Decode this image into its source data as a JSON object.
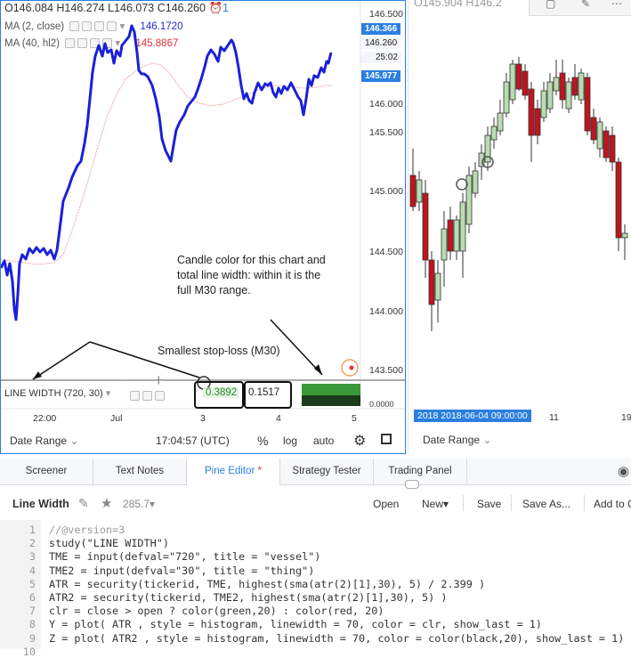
{
  "left_chart": {
    "ohlc": {
      "o": "O146.084",
      "h": "H146.274",
      "l": "L146.073",
      "c": "C146.260",
      "alert_count": "1"
    },
    "indicators": [
      {
        "label": "MA (2, close)",
        "value": "146.1720",
        "color": "#2a2ad0"
      },
      {
        "label": "MA (40, hl2)",
        "value": "145.8867",
        "color": "#e0303a"
      }
    ],
    "price_axis": [
      "146.500",
      "146.000",
      "145.500",
      "145.000",
      "144.500",
      "144.000",
      "143.500"
    ],
    "price_tags": [
      {
        "text": "146.366",
        "color": "#2a7fe0"
      },
      {
        "text": "146.260",
        "color": "#ffffff"
      },
      {
        "text": "25:02",
        "color": "#ffffff"
      },
      {
        "text": "145.977",
        "color": "#2a7fe0"
      }
    ],
    "lower_pane": {
      "label": "LINE WIDTH (720, 30)",
      "value1": "0.3892",
      "value2": "0.1517",
      "axis": "0.0000"
    },
    "time_axis": [
      "22:00",
      "Jul",
      "3",
      "4",
      "5"
    ],
    "bottom_bar": {
      "date_range": "Date Range",
      "time": "17:04:57 (UTC)",
      "percent": "%",
      "log": "log",
      "auto": "auto"
    },
    "annotation1": "Candle color for this chart and total line width: within it is the full M30 range.",
    "annotation2": "Smallest stop-loss (M30)"
  },
  "right_chart": {
    "ohlc": "O145.904  H146.2",
    "time_label": "2018  2018-06-04 09:00:00",
    "time_axis": [
      "11",
      "19"
    ],
    "date_range": "Date Range"
  },
  "tabs": [
    "Screener",
    "Text Notes",
    "Pine Editor",
    "Strategy Tester",
    "Trading Panel"
  ],
  "active_tab": "Pine Editor",
  "active_tab_marker": "*",
  "editor": {
    "script_name": "Line Width",
    "star_count": "285.7",
    "buttons": {
      "open": "Open",
      "new": "New",
      "save": "Save",
      "save_as": "Save As...",
      "add_to_chart": "Add to C"
    }
  },
  "code_lines": [
    "//@version=3",
    "study(\"LINE WIDTH\")",
    "TME = input(defval=\"720\", title = \"vessel\")",
    "TME2 = input(defval=\"30\", title = \"thing\")",
    "ATR = security(tickerid, TME, highest(sma(atr(2)[1],30), 5) / 2.399 )",
    "ATR2 = security(tickerid, TME2, highest(sma(atr(2)[1],30), 5) )",
    "clr = close > open ? color(green,20) : color(red, 20)",
    "Y = plot( ATR , style = histogram, linewidth = 70, color = clr, show_last = 1)",
    "Z = plot( ATR2 , style = histogram, linewidth = 70, color = color(black,20), show_last = 1)",
    ""
  ],
  "colors": {
    "accent": "#2a7fe0",
    "ma2": "#2a2ad0",
    "ma40": "#f0a0a0",
    "up": "#b9dcb0",
    "down": "#c0141e",
    "green_bar": "#3a9a3a",
    "dark_bar": "#1c3a1c"
  }
}
